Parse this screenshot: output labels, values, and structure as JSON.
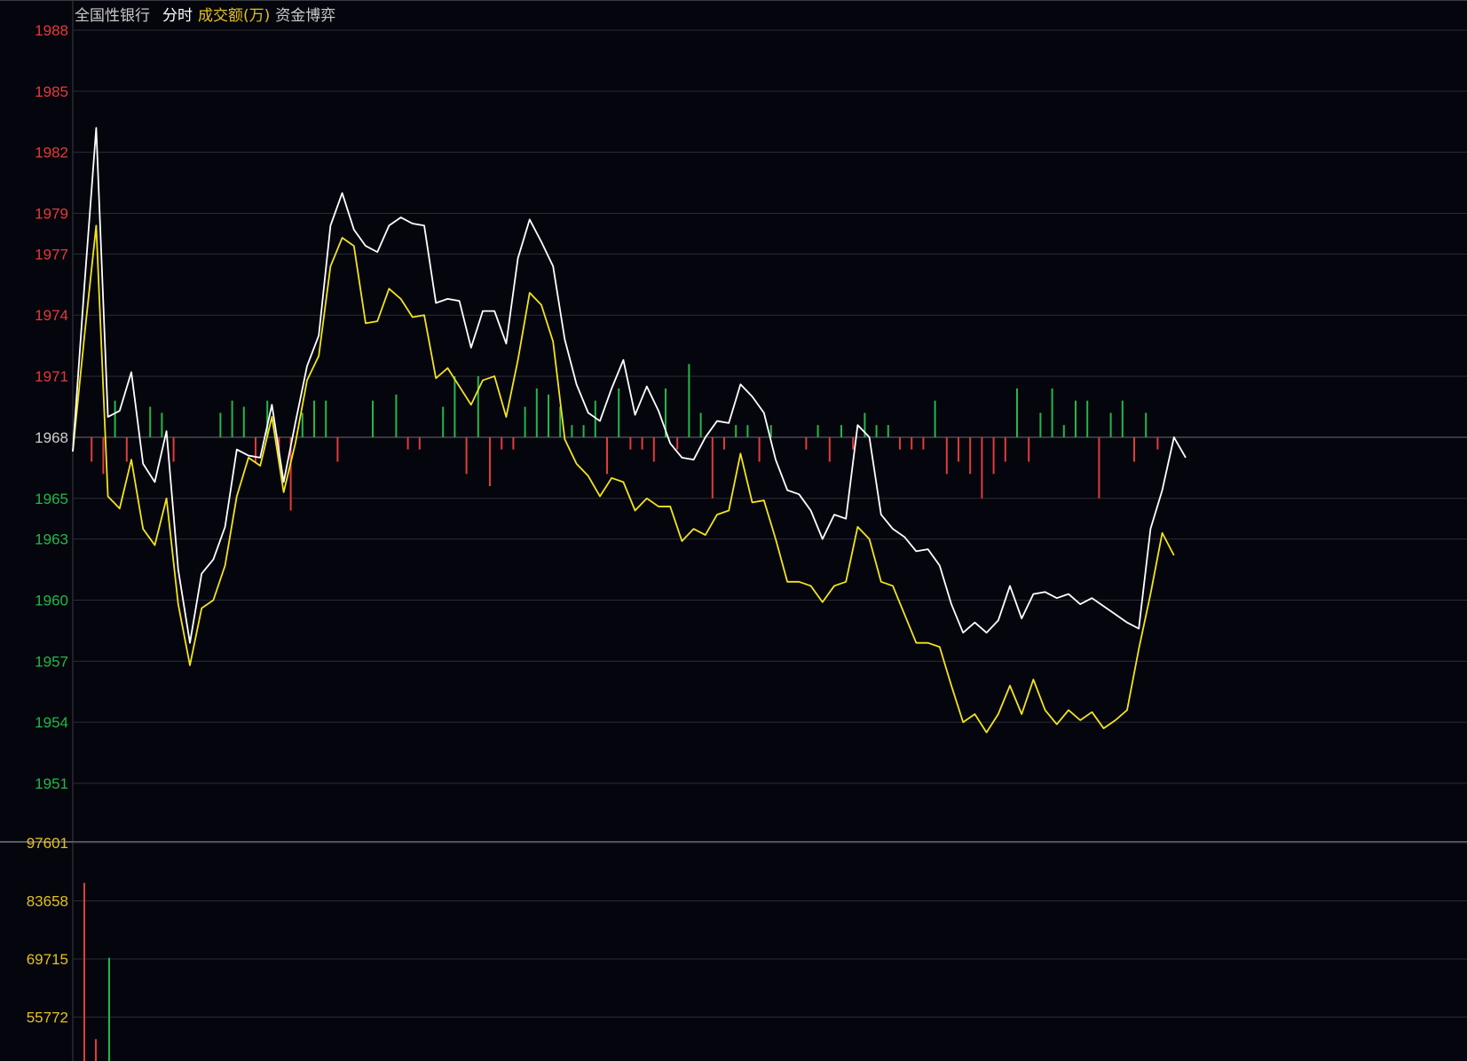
{
  "header": {
    "index_name": "全国性银行",
    "mode": "分时",
    "indicator": "成交额(万)",
    "fund_game": "资金博弈"
  },
  "colors": {
    "background": "#05050d",
    "grid": "#2c2c34",
    "up": "#e23b3b",
    "down": "#22b84a",
    "price_line": "#ffffff",
    "avg_line": "#f2e41c",
    "volume_axis": "#e4c21c"
  },
  "chart_data": [
    {
      "type": "line",
      "panel": "intraday-price",
      "ylim": [
        1951,
        1988
      ],
      "base": 1968,
      "y_ticks": [
        "1988",
        "1985",
        "1982",
        "1979",
        "1977",
        "1974",
        "1971",
        "1968",
        "1965",
        "1963",
        "1960",
        "1957",
        "1954",
        "1951"
      ],
      "y_tick_values": [
        1988,
        1985,
        1982,
        1979,
        1977,
        1974,
        1971,
        1968,
        1965,
        1963,
        1960,
        1957,
        1954,
        1951
      ],
      "x": [
        0,
        1,
        2,
        3,
        4,
        5,
        6,
        7,
        8,
        9,
        10,
        11,
        12,
        13,
        14,
        15,
        16,
        17,
        18,
        19,
        20,
        21,
        22,
        23,
        24,
        25,
        26,
        27,
        28,
        29,
        30,
        31,
        32,
        33,
        34,
        35,
        36,
        37,
        38,
        39,
        40,
        41,
        42,
        43,
        44,
        45,
        46,
        47,
        48,
        49,
        50,
        51,
        52,
        53,
        54,
        55,
        56,
        57,
        58,
        59,
        60,
        61,
        62,
        63,
        64,
        65,
        66,
        67,
        68,
        69,
        70,
        71,
        72,
        73,
        74,
        75,
        76,
        77,
        78,
        79,
        80,
        81,
        82,
        83,
        84,
        85,
        86,
        87,
        88,
        89,
        90,
        91,
        92,
        93
      ],
      "series": [
        {
          "name": "price",
          "values": [
            1967.3,
            1975.5,
            1983.2,
            1969.0,
            1969.3,
            1971.2,
            1966.7,
            1965.8,
            1968.3,
            1961.5,
            1957.9,
            1961.3,
            1962.0,
            1963.6,
            1967.4,
            1967.1,
            1967.0,
            1969.6,
            1965.8,
            1968.7,
            1971.5,
            1973.0,
            1978.4,
            1980.0,
            1978.2,
            1977.4,
            1977.1,
            1978.4,
            1978.8,
            1978.5,
            1978.4,
            1974.6,
            1974.8,
            1974.7,
            1972.4,
            1974.2,
            1974.2,
            1972.6,
            1976.8,
            1978.7,
            1977.6,
            1976.4,
            1972.8,
            1970.6,
            1969.2,
            1968.8,
            1970.4,
            1971.8,
            1969.1,
            1970.5,
            1969.3,
            1967.7,
            1967.0,
            1966.9,
            1968.0,
            1968.8,
            1968.7,
            1970.6,
            1970.0,
            1969.2,
            1966.9,
            1965.4,
            1965.2,
            1964.4,
            1963.0,
            1964.2,
            1964.0,
            1968.6,
            1968.0,
            1964.2,
            1963.5,
            1963.1,
            1962.4,
            1962.5,
            1961.7,
            1959.8,
            1958.4,
            1958.9,
            1958.4,
            1959.0,
            1960.7,
            1959.1,
            1960.3,
            1960.4,
            1960.1,
            1960.3,
            1959.8,
            1960.1,
            1959.7,
            1959.3,
            1958.9,
            1958.6,
            1963.5,
            1965.4,
            1968.0,
            1967.0
          ],
          "color": "#ffffff"
        },
        {
          "name": "average",
          "values": [
            1967.3,
            1973.0,
            1978.4,
            1965.1,
            1964.5,
            1966.9,
            1963.5,
            1962.7,
            1965.0,
            1959.8,
            1956.8,
            1959.6,
            1960.0,
            1961.7,
            1965.1,
            1967.0,
            1966.6,
            1969.0,
            1965.3,
            1967.7,
            1970.8,
            1972.0,
            1976.4,
            1977.8,
            1977.4,
            1973.6,
            1973.7,
            1975.3,
            1974.8,
            1973.9,
            1974.0,
            1970.9,
            1971.4,
            1970.5,
            1969.6,
            1970.8,
            1971.0,
            1969.0,
            1971.8,
            1975.1,
            1974.5,
            1972.7,
            1967.9,
            1966.7,
            1966.1,
            1965.1,
            1966.0,
            1965.8,
            1964.4,
            1965.0,
            1964.6,
            1964.6,
            1962.9,
            1963.5,
            1963.2,
            1964.2,
            1964.4,
            1967.2,
            1964.8,
            1964.9,
            1963.0,
            1960.9,
            1960.9,
            1960.7,
            1959.9,
            1960.7,
            1960.9,
            1963.6,
            1963.0,
            1960.9,
            1960.7,
            1959.3,
            1957.9,
            1957.9,
            1957.7,
            1955.8,
            1954.0,
            1954.4,
            1953.5,
            1954.4,
            1955.8,
            1954.4,
            1956.1,
            1954.6,
            1953.9,
            1954.6,
            1954.1,
            1954.5,
            1953.7,
            1954.1,
            1954.6,
            1957.6,
            1960.3,
            1963.3,
            1962.2
          ],
          "color": "#f2e41c"
        },
        {
          "name": "fund-flow-bars",
          "x": [
            1,
            2,
            3,
            4,
            6,
            7,
            8,
            12,
            13,
            14,
            15,
            16,
            17,
            18,
            19,
            20,
            21,
            22,
            25,
            27,
            28,
            29,
            31,
            32,
            33,
            34,
            35,
            36,
            37,
            38,
            39,
            40,
            41,
            42,
            43,
            44,
            45,
            46,
            47,
            48,
            49,
            50,
            51,
            52,
            53,
            54,
            55,
            56,
            57,
            58,
            59,
            62,
            63,
            64,
            65,
            66,
            67,
            68,
            69,
            70,
            71,
            72,
            73,
            74,
            75,
            76,
            77,
            78,
            79,
            80,
            81,
            82,
            83,
            84,
            85,
            86,
            87,
            88,
            89,
            90,
            91,
            92
          ],
          "values": [
            4.0,
            6.0,
            -6.0,
            4.0,
            -5.0,
            -4.0,
            4.0,
            -4.0,
            -6.0,
            -5.0,
            4.0,
            -6.0,
            3.0,
            12.0,
            -4.0,
            -6.0,
            -6.0,
            4.0,
            -6.0,
            -7.0,
            2.0,
            2.0,
            -5.0,
            -10.0,
            6.0,
            -10.0,
            8.0,
            2.0,
            2.0,
            -5.0,
            -8.0,
            -7.0,
            -5.0,
            -2.0,
            -2.0,
            -6.0,
            6.0,
            -8.0,
            2.0,
            2.0,
            4.0,
            -8.0,
            2.0,
            -12.0,
            -4.0,
            10.0,
            2.0,
            -2.0,
            -2.0,
            4.0,
            -2.0,
            2.0,
            -2.0,
            4.0,
            -2.0,
            2.0,
            -4.0,
            -2.0,
            -2.0,
            2.0,
            2.0,
            2.0,
            -6.0,
            6.0,
            4.0,
            6.0,
            10.0,
            6.0,
            4.0,
            -8.0,
            4.0,
            -4.0,
            -8.0,
            -2.0,
            -6.0,
            -6.0,
            10.0,
            -4.0,
            -6.0,
            4.0,
            -4.0,
            2.0
          ],
          "value_unit": "tenths of price unit relative to base 1968"
        }
      ]
    },
    {
      "type": "bar",
      "panel": "volume",
      "ylabel": "成交额(万)",
      "y_ticks": [
        "97601",
        "83658",
        "69715",
        "55772"
      ],
      "y_tick_values": [
        97601,
        83658,
        69715,
        55772
      ],
      "ylim": [
        44000,
        97601
      ],
      "x": [
        0,
        1,
        2,
        3
      ],
      "values": [
        44000,
        88000,
        50500,
        70000
      ],
      "directions": [
        "up",
        "up",
        "up",
        "down"
      ]
    }
  ]
}
